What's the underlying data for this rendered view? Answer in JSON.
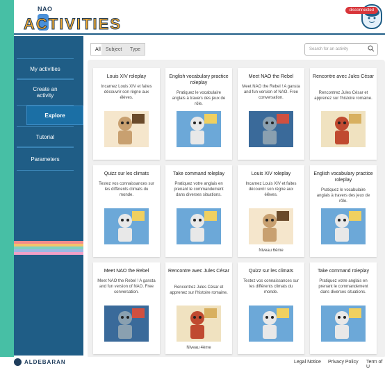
{
  "header": {
    "logo_small": "NAO",
    "logo_big": "ACTIVITIES",
    "status": "disconnected"
  },
  "sidebar": {
    "items": [
      {
        "label": "My activities"
      },
      {
        "label": "Create an activity"
      },
      {
        "label": "Explore"
      },
      {
        "label": "Tutorial"
      },
      {
        "label": "Parameters"
      }
    ],
    "stripe_colors": [
      "#f28c8c",
      "#f4c36a",
      "#7fd1c2",
      "#9ab8e3",
      "#f0a0c8"
    ]
  },
  "filters": {
    "tabs": [
      "All",
      "Subject",
      "Type"
    ],
    "search_placeholder": "Search for an activity"
  },
  "cards": [
    {
      "title": "Louis XIV roleplay",
      "desc": "Incarnez Louis XIV et faites découvrir son règne aux élèves.",
      "image": "louis-xiv-robot",
      "level": ""
    },
    {
      "title": "English vocabulary practice roleplay",
      "desc": "Pratiquez le vocabulaire anglais à travers des jeux de rôle.",
      "image": "classroom-robot",
      "level": ""
    },
    {
      "title": "Meet NAO the Rebel",
      "desc": "Meet NAO the Rebel ! A gansta and fun version of NAO. Free conversation.",
      "image": "rebel-robot",
      "level": ""
    },
    {
      "title": "Rencontre avec Jules César",
      "desc": "Rencontrez Jules César et apprenez sur l'histoire romaine.",
      "image": "caesar-robot",
      "level": ""
    },
    {
      "title": "Quizz sur les climats",
      "desc": "Testez vos connaissances sur les différents climats du monde.",
      "image": "classroom-robot",
      "level": ""
    },
    {
      "title": "Take command roleplay",
      "desc": "Pratiquez votre anglais en prenant le commandement dans diverses situations.",
      "image": "classroom-robot",
      "level": ""
    },
    {
      "title": "Louis XIV roleplay",
      "desc": "Incarnez Louis XIV et faites découvrir son règne aux élèves.",
      "image": "louis-xiv-robot",
      "level": "Niveau 6ème"
    },
    {
      "title": "English vocabulary practice roleplay",
      "desc": "Pratiquez le vocabulaire anglais à travers des jeux de rôle.",
      "image": "classroom-robot",
      "level": ""
    },
    {
      "title": "Meet NAO the Rebel",
      "desc": "Meet NAO the Rebel ! A gansta and fun version of NAO. Free conversation.",
      "image": "rebel-robot",
      "level": ""
    },
    {
      "title": "Rencontre avec Jules César",
      "desc": "Rencontrez Jules César et apprenez sur l'histoire romaine.",
      "image": "caesar-robot",
      "level": "Niveau 4ème"
    },
    {
      "title": "Quizz sur les climats",
      "desc": "Testez vos connaissances sur les différents climats du monde.",
      "image": "classroom-robot",
      "level": ""
    },
    {
      "title": "Take command roleplay",
      "desc": "Pratiquez votre anglais en prenant le commandement dans diverses situations.",
      "image": "classroom-robot",
      "level": ""
    }
  ],
  "footer": {
    "brand": "ALDEBARAN",
    "links": [
      "Legal Notice",
      "Privacy Policy",
      "Term of U"
    ]
  }
}
